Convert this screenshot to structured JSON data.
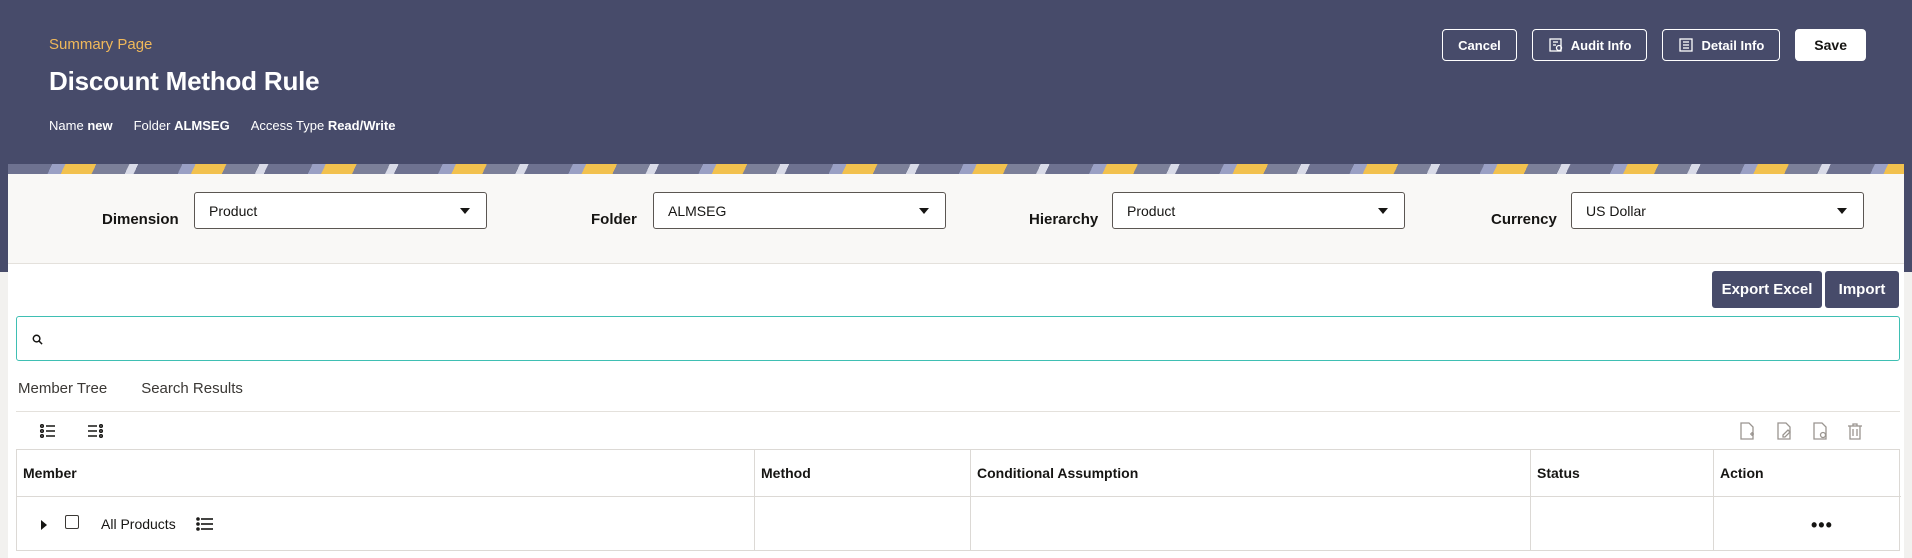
{
  "header": {
    "breadcrumb": "Summary Page",
    "title": "Discount Method Rule",
    "meta": {
      "name_label": "Name",
      "name_value": "new",
      "folder_label": "Folder",
      "folder_value": "ALMSEG",
      "access_label": "Access Type",
      "access_value": "Read/Write"
    },
    "buttons": {
      "cancel": "Cancel",
      "audit": "Audit Info",
      "detail": "Detail Info",
      "save": "Save"
    }
  },
  "filters": {
    "dimension": {
      "label": "Dimension",
      "value": "Product"
    },
    "folder": {
      "label": "Folder",
      "value": "ALMSEG"
    },
    "hierarchy": {
      "label": "Hierarchy",
      "value": "Product"
    },
    "currency": {
      "label": "Currency",
      "value": "US Dollar"
    }
  },
  "actions": {
    "export": "Export Excel",
    "import": "Import"
  },
  "search": {
    "placeholder": ""
  },
  "tabs": [
    "Member Tree",
    "Search Results"
  ],
  "table": {
    "columns": [
      "Member",
      "Method",
      "Conditional Assumption",
      "Status",
      "Action"
    ],
    "rows": [
      {
        "member": "All Products",
        "method": "",
        "conditional": "",
        "status": "",
        "action": "•••"
      }
    ]
  },
  "colors": {
    "header_bg": "#474b6a",
    "breadcrumb": "#f0b85a",
    "search_border": "#3fbfb3",
    "button_bg": "#474b6a"
  }
}
